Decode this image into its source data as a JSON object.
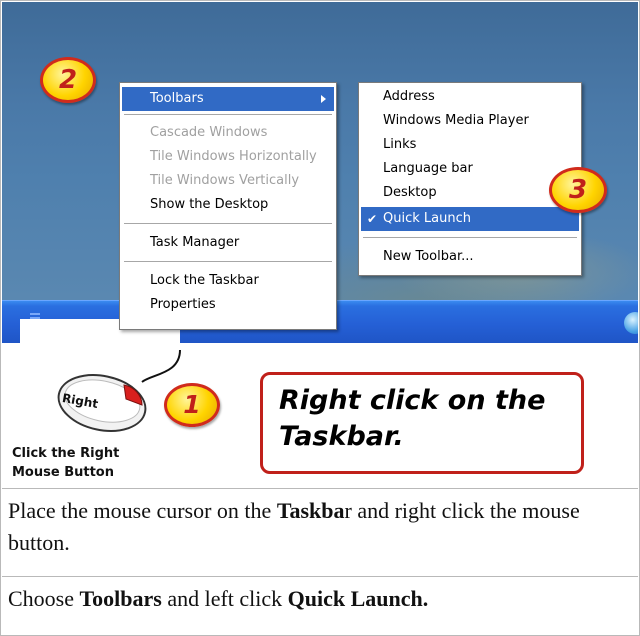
{
  "context_menu": {
    "items": [
      {
        "label": "Toolbars",
        "highlighted": true,
        "has_submenu": true
      },
      {
        "label": "Cascade Windows",
        "disabled": true
      },
      {
        "label": "Tile Windows Horizontally",
        "disabled": true
      },
      {
        "label": "Tile Windows Vertically",
        "disabled": true
      },
      {
        "label": "Show the Desktop"
      },
      {
        "label": "Task Manager"
      },
      {
        "label": "Lock the Taskbar"
      },
      {
        "label": "Properties"
      }
    ]
  },
  "toolbars_submenu": {
    "items": [
      {
        "label": "Address"
      },
      {
        "label": "Windows Media Player"
      },
      {
        "label": "Links"
      },
      {
        "label": "Language bar"
      },
      {
        "label": "Desktop"
      },
      {
        "label": "Quick Launch",
        "checked": true,
        "highlighted": true
      },
      {
        "label": "New Toolbar..."
      }
    ]
  },
  "badges": {
    "step1": "1",
    "step2": "2",
    "step3": "3"
  },
  "mouse": {
    "button_label": "Right",
    "caption_line1": "Click the Right",
    "caption_line2": "Mouse Button"
  },
  "callout": {
    "line1": "Right click on the",
    "line2": "Taskbar."
  },
  "instructions": {
    "step1": {
      "before": "Place the mouse cursor on the ",
      "bold": "Taskba",
      "after": "r and right click the mouse button."
    },
    "step2": {
      "before": "Choose ",
      "bold1": "Toolbars",
      "middle": " and left click ",
      "bold2": "Quick Launch."
    }
  },
  "colors": {
    "menu_highlight": "#316ac5",
    "taskbar": "#2560d6",
    "badge_border": "#d02b1c",
    "callout_border": "#c0201a"
  }
}
